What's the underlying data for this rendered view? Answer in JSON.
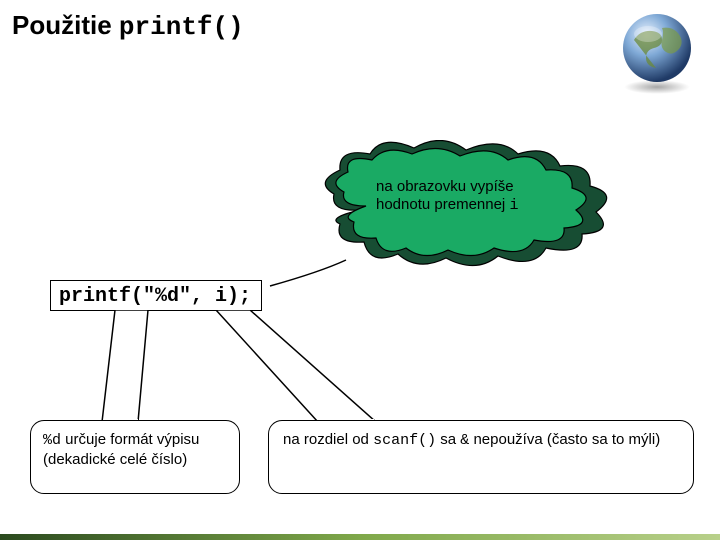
{
  "title": {
    "prefix": "Použitie ",
    "code": "printf()"
  },
  "cloud": {
    "line1": "na obrazovku vypíše",
    "line2_prefix": "hodnotu premennej ",
    "line2_code": "i"
  },
  "codebox": {
    "content": "printf(\"%d\", i);"
  },
  "callout_left": {
    "code_prefix": "%d",
    "text_rest": " určuje formát výpisu (dekadické celé číslo)"
  },
  "callout_right": {
    "part1": "na rozdiel od ",
    "code1": "scanf()",
    "part2": " sa ",
    "code2": "&",
    "part3": "  nepoužíva (často sa to mýli)"
  }
}
